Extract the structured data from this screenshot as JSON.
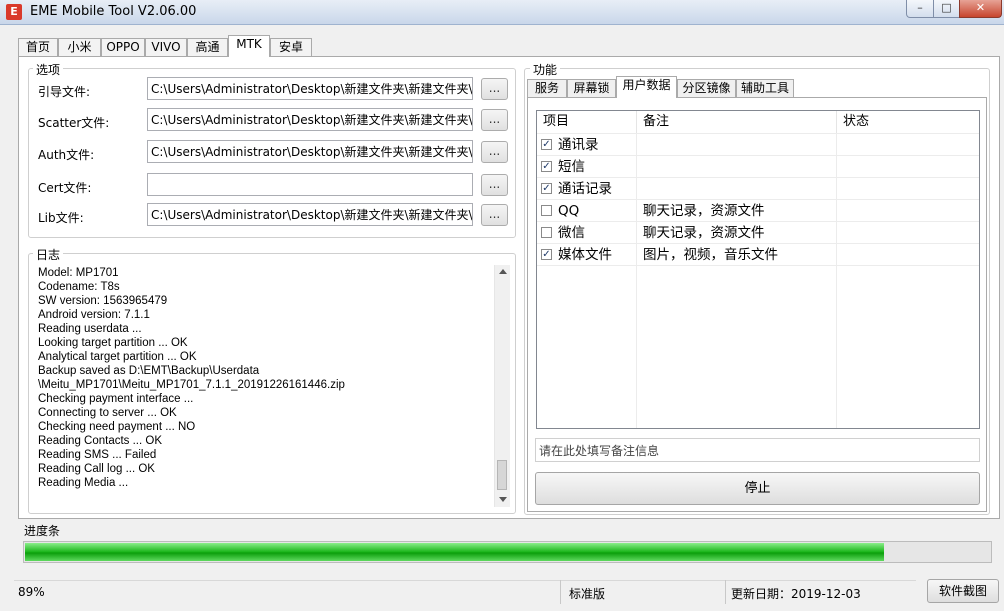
{
  "window": {
    "title": "EME Mobile Tool V2.06.00",
    "icon": "E"
  },
  "window_buttons": {
    "minimize": "–",
    "maximize": "□",
    "close": "✕"
  },
  "main_tabs": [
    "首页",
    "小米",
    "OPPO",
    "VIVO",
    "高通",
    "MTK",
    "安卓"
  ],
  "active_main_tab": "MTK",
  "options": {
    "title": "选项",
    "rows": [
      {
        "label": "引导文件:",
        "value": "C:\\Users\\Administrator\\Desktop\\新建文件夹\\新建文件夹\\DA",
        "button": "..."
      },
      {
        "label": "Scatter文件:",
        "value": "C:\\Users\\Administrator\\Desktop\\新建文件夹\\新建文件夹\\PR",
        "button": "..."
      },
      {
        "label": "Auth文件:",
        "value": "C:\\Users\\Administrator\\Desktop\\新建文件夹\\新建文件夹\\AU",
        "button": "..."
      },
      {
        "label": "Cert文件:",
        "value": "",
        "button": "..."
      },
      {
        "label": "Lib文件:",
        "value": "C:\\Users\\Administrator\\Desktop\\新建文件夹\\新建文件夹\\LIB",
        "button": "..."
      }
    ]
  },
  "log": {
    "title": "日志",
    "lines": [
      "Model: MP1701",
      "Codename: T8s",
      "SW version: 1563965479",
      "Android version: 7.1.1",
      "Reading userdata ...",
      "Looking target partition ... OK",
      "Analytical target partition ... OK",
      "Backup saved as D:\\EMT\\Backup\\Userdata",
      "\\Meitu_MP1701\\Meitu_MP1701_7.1.1_20191226161446.zip",
      "Checking payment interface ...",
      "Connecting to server ... OK",
      "Checking need payment ... NO",
      "Reading Contacts ... OK",
      "Reading SMS ... Failed",
      "Reading Call log ... OK",
      "Reading  Media ..."
    ]
  },
  "functions": {
    "title": "功能",
    "tabs": [
      "服务",
      "屏幕锁",
      "用户数据",
      "分区镜像",
      "辅助工具"
    ],
    "active_tab": "用户数据",
    "columns": [
      "项目",
      "备注",
      "状态"
    ],
    "items": [
      {
        "name": "通讯录",
        "note": "",
        "status": "",
        "checked": true
      },
      {
        "name": "短信",
        "note": "",
        "status": "",
        "checked": true
      },
      {
        "name": "通话记录",
        "note": "",
        "status": "",
        "checked": true
      },
      {
        "name": "QQ",
        "note": "聊天记录，资源文件",
        "status": "",
        "checked": false
      },
      {
        "name": "微信",
        "note": "聊天记录，资源文件",
        "status": "",
        "checked": false
      },
      {
        "name": "媒体文件",
        "note": "图片，视频，音乐文件",
        "status": "",
        "checked": true
      }
    ],
    "note_placeholder": "请在此处填写备注信息",
    "stop_label": "停止"
  },
  "progress": {
    "label": "进度条",
    "value": 0.89
  },
  "statusbar": {
    "percent": "89%",
    "edition": "标准版",
    "update_date": "更新日期：2019-12-03",
    "screenshot_label": "软件截图"
  },
  "colors": {
    "progress_fill": "#1ab51a",
    "close_button": "#c7452d",
    "checkbox_mark": "#1f3a68"
  }
}
